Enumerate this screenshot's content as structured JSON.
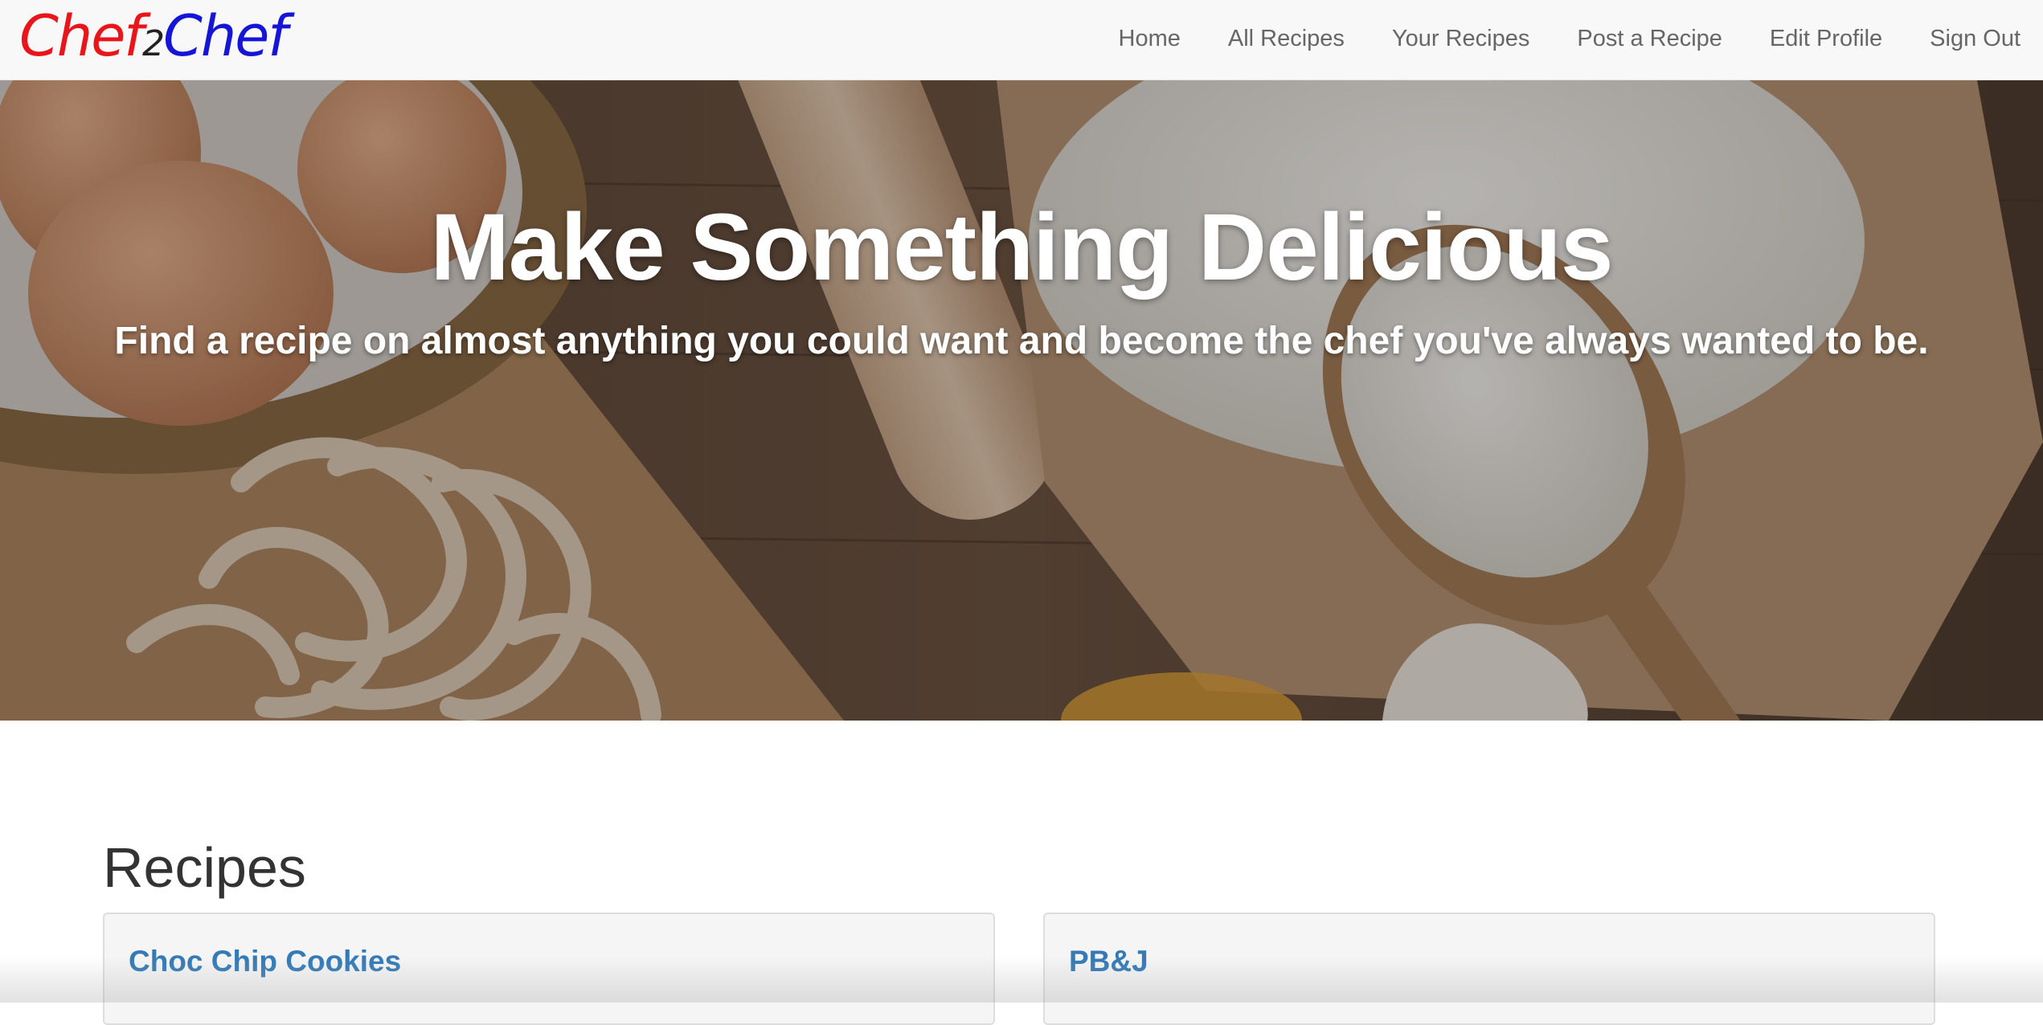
{
  "brand": {
    "part1": "Chef",
    "part2": "2",
    "part3": "Chef"
  },
  "nav": {
    "items": [
      {
        "label": "Home"
      },
      {
        "label": "All Recipes"
      },
      {
        "label": "Your Recipes"
      },
      {
        "label": "Post a Recipe"
      },
      {
        "label": "Edit Profile"
      },
      {
        "label": "Sign Out"
      }
    ]
  },
  "hero": {
    "title": "Make Something Delicious",
    "subtitle": "Find a recipe on almost anything you could want and become the chef you've always wanted to be."
  },
  "recipes": {
    "heading": "Recipes",
    "cards": [
      {
        "title": "Choc Chip Cookies"
      },
      {
        "title": "PB&J"
      }
    ]
  },
  "colors": {
    "brand_red": "#e8161b",
    "brand_blue": "#1515d8",
    "link_blue": "#337ab7"
  }
}
